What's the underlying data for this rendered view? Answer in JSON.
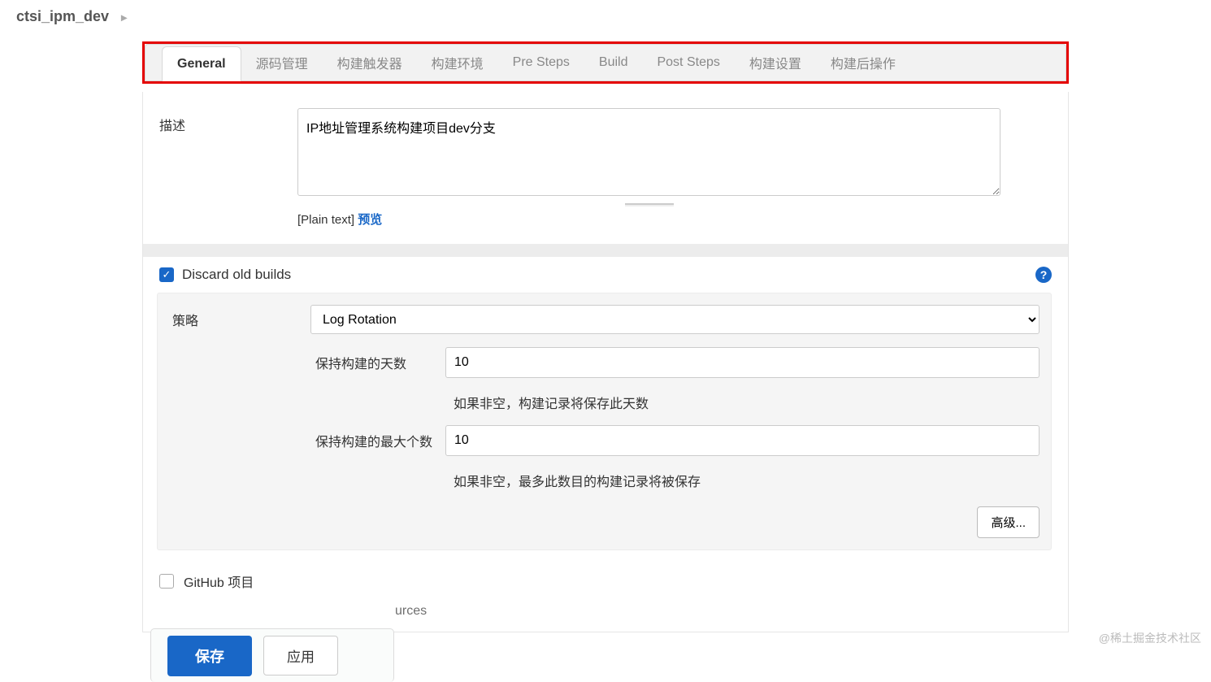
{
  "breadcrumb": {
    "title": "ctsi_ipm_dev"
  },
  "tabs": [
    {
      "label": "General",
      "active": true
    },
    {
      "label": "源码管理"
    },
    {
      "label": "构建触发器"
    },
    {
      "label": "构建环境"
    },
    {
      "label": "Pre Steps"
    },
    {
      "label": "Build"
    },
    {
      "label": "Post Steps"
    },
    {
      "label": "构建设置"
    },
    {
      "label": "构建后操作"
    }
  ],
  "description": {
    "label": "描述",
    "value": "IP地址管理系统构建项目dev分支",
    "plain_text_label": "[Plain text]",
    "preview_label": "预览"
  },
  "discard": {
    "label": "Discard old builds",
    "checked": true
  },
  "strategy": {
    "label": "策略",
    "selected": "Log Rotation",
    "days_label": "保持构建的天数",
    "days_value": "10",
    "days_help": "如果非空，构建记录将保存此天数",
    "max_label": "保持构建的最大个数",
    "max_value": "10",
    "max_help": "如果非空，最多此数目的构建记录将被保存",
    "advanced_label": "高级..."
  },
  "lower": {
    "github_label": "GitHub 项目",
    "partial_suffix": "urces"
  },
  "actions": {
    "save": "保存",
    "apply": "应用"
  },
  "watermark": "@稀土掘金技术社区"
}
